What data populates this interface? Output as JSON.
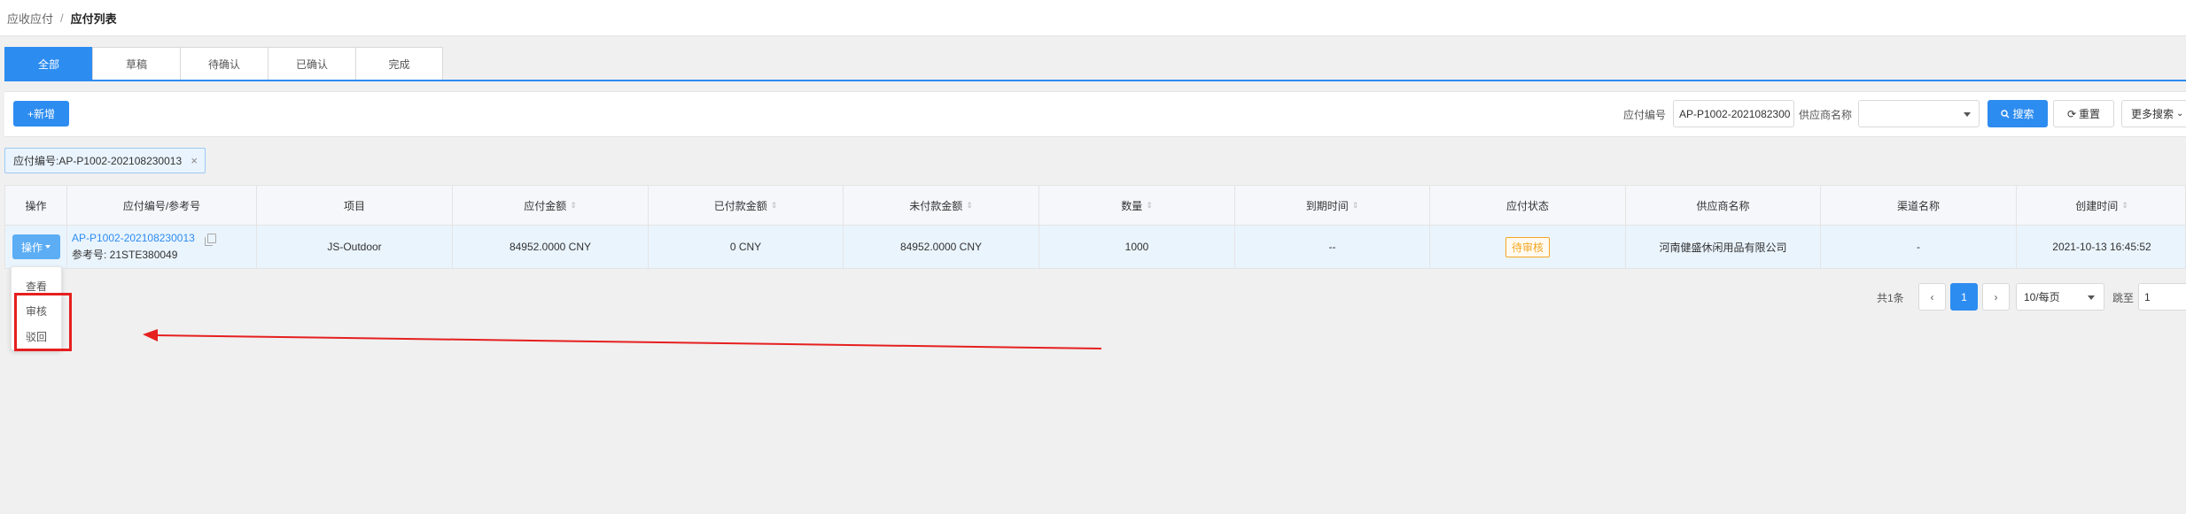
{
  "breadcrumb": {
    "parent": "应收应付",
    "separator": "/",
    "current": "应付列表"
  },
  "tabs": [
    {
      "label": "全部",
      "active": true
    },
    {
      "label": "草稿",
      "active": false
    },
    {
      "label": "待确认",
      "active": false
    },
    {
      "label": "已确认",
      "active": false
    },
    {
      "label": "完成",
      "active": false
    }
  ],
  "toolbar": {
    "add_label": "+新增",
    "code_label": "应付编号",
    "code_value": "AP-P1002-2021082300",
    "supplier_label": "供应商名称",
    "supplier_value": "",
    "search_label": "搜索",
    "reset_label": "重置",
    "more_label": "更多搜索"
  },
  "filter_chip": {
    "label": "应付编号:AP-P1002-202108230013",
    "close": "×"
  },
  "table": {
    "headers": [
      "操作",
      "应付编号/参考号",
      "项目",
      "应付金额",
      "已付款金额",
      "未付款金额",
      "数量",
      "到期时间",
      "应付状态",
      "供应商名称",
      "渠道名称",
      "创建时间"
    ],
    "row": {
      "op_label": "操作",
      "code": "AP-P1002-202108230013",
      "ref": "参考号: 21STE380049",
      "project": "JS-Outdoor",
      "amount": "84952.0000 CNY",
      "paid": "0 CNY",
      "unpaid": "84952.0000 CNY",
      "quantity": "1000",
      "due": "--",
      "status": "待审核",
      "supplier": "河南健盛休闲用品有限公司",
      "channel": "-",
      "created": "2021-10-13 16:45:52"
    }
  },
  "dropdown": {
    "items": [
      "查看",
      "审核",
      "驳回"
    ]
  },
  "pagination": {
    "total": "共1条",
    "prev": "‹",
    "current": "1",
    "next": "›",
    "page_size": "10/每页",
    "jump_label": "跳至",
    "jump_value": "1"
  },
  "colors": {
    "primary": "#2d8cf0",
    "annotation": "#e61f1f",
    "status": "#f5a623"
  }
}
